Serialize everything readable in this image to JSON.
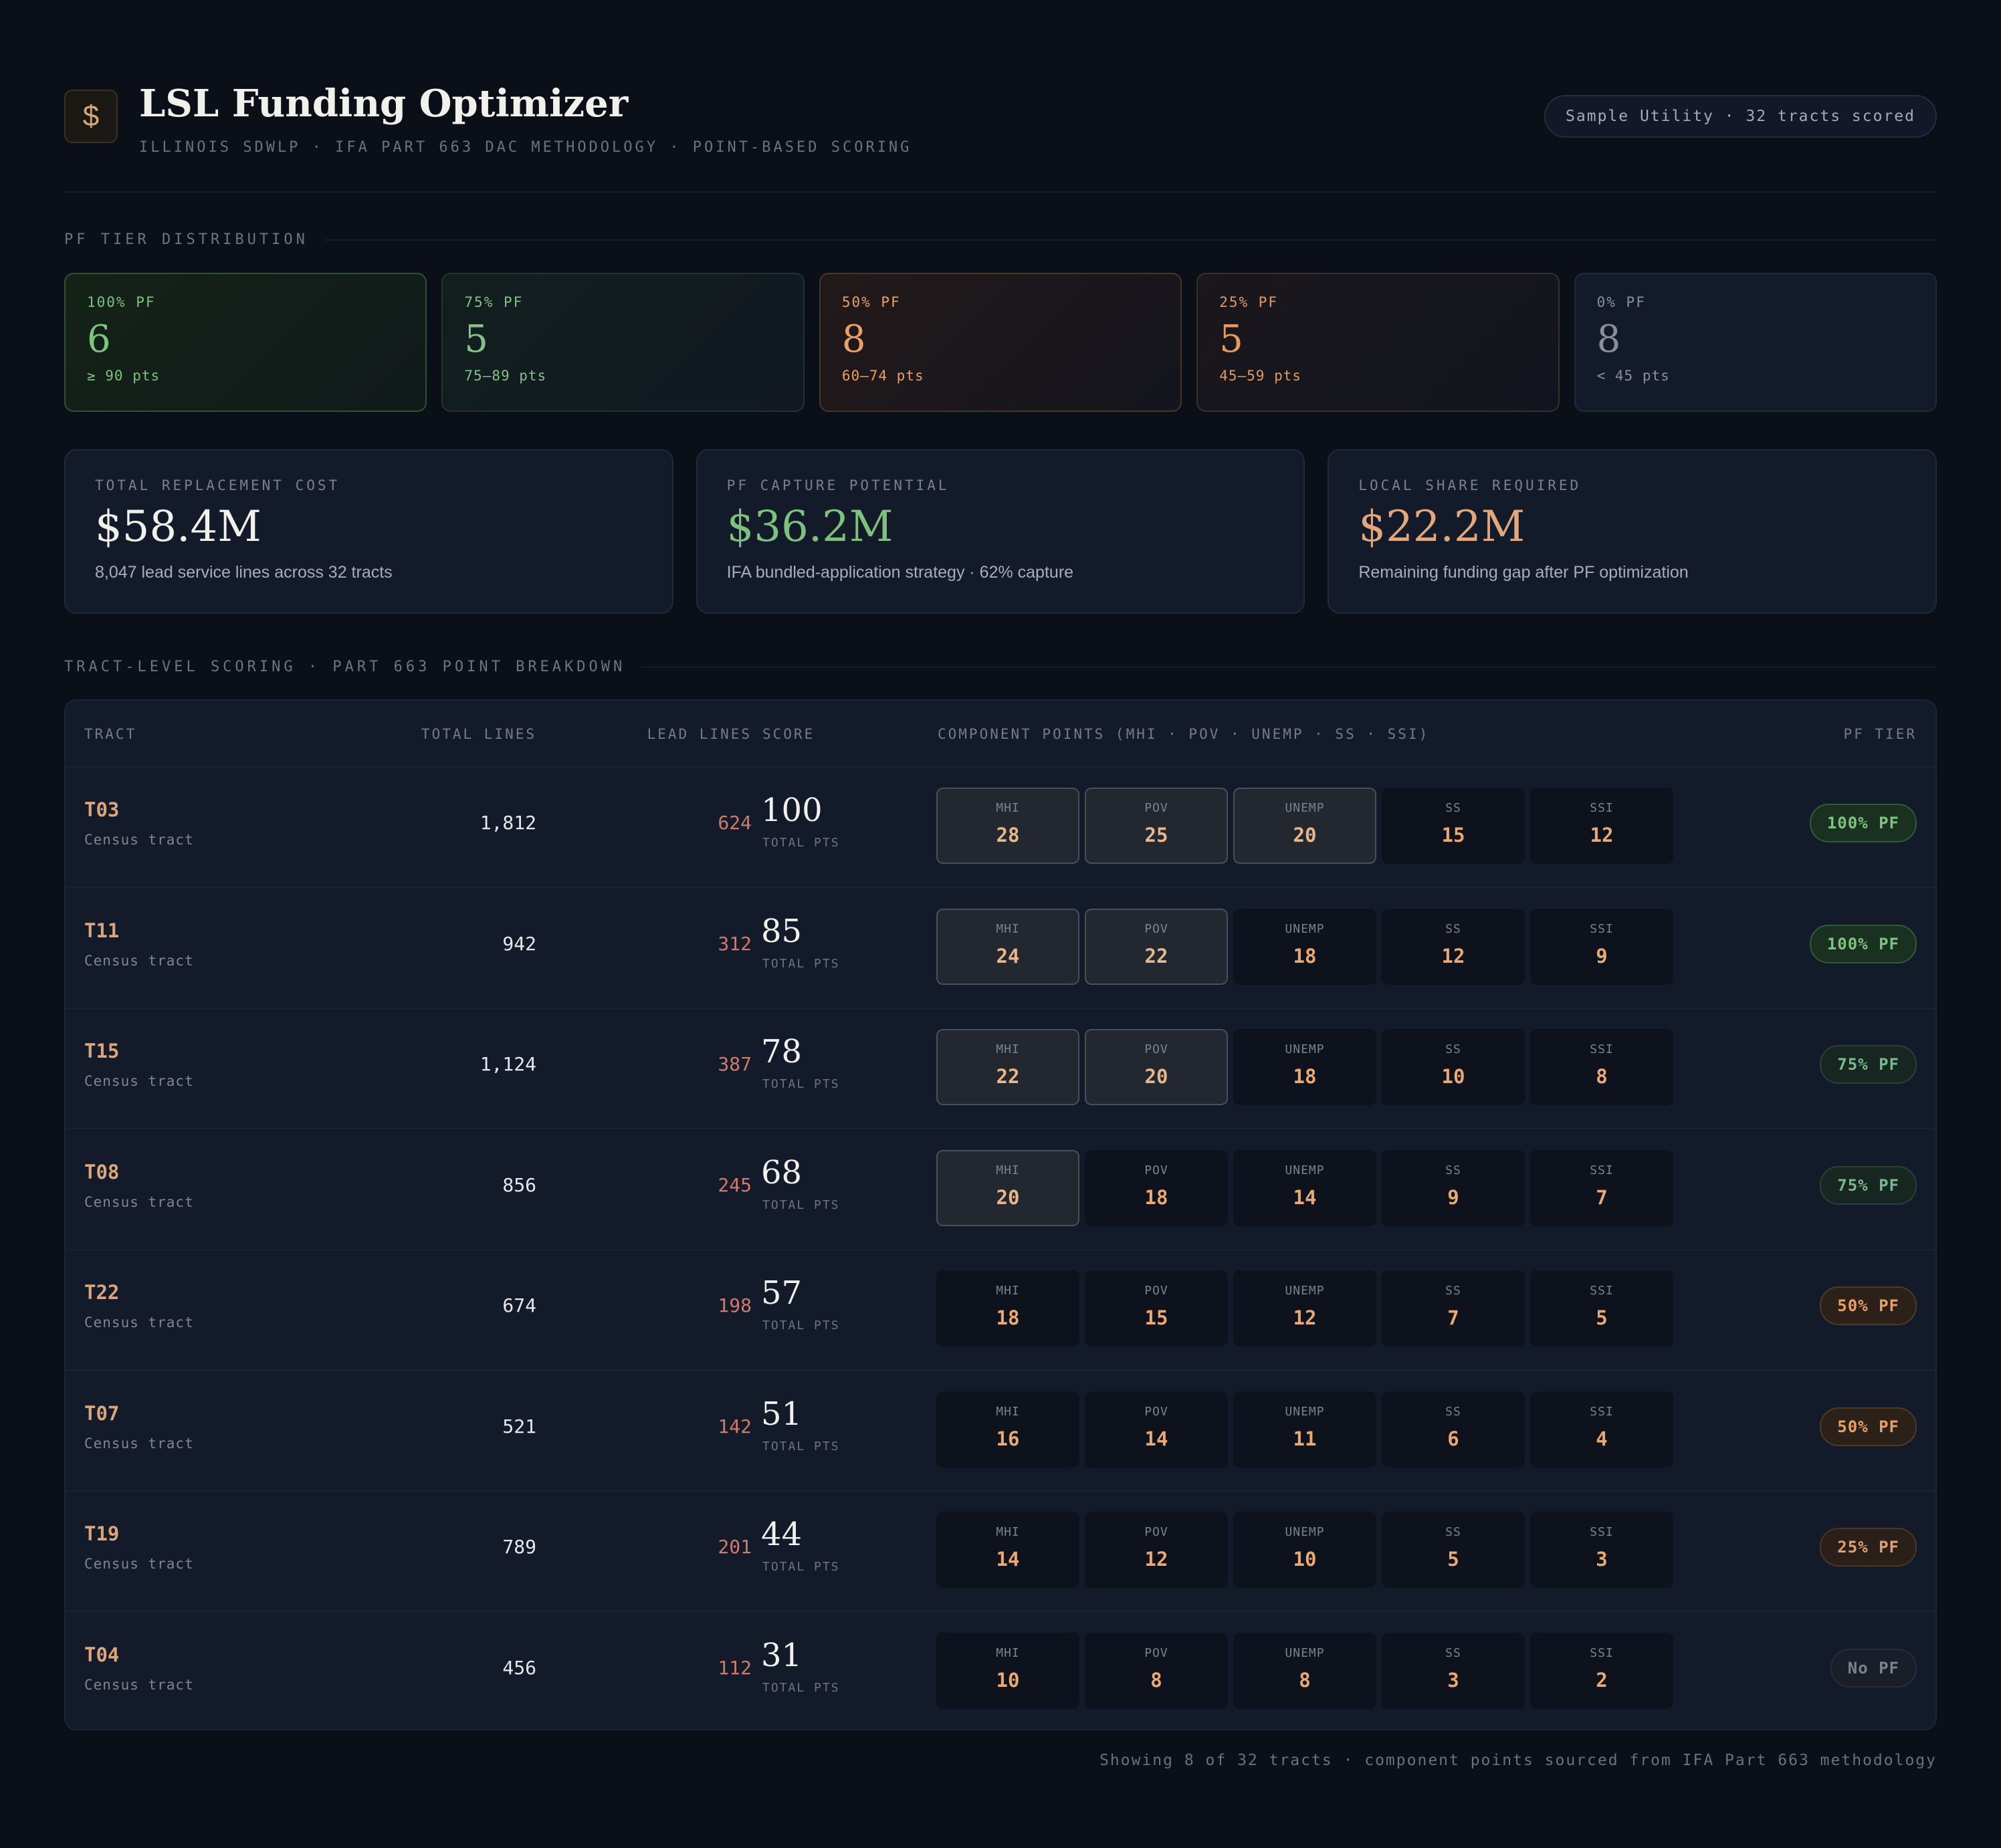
{
  "header": {
    "logo_glyph": "$",
    "title": "LSL Funding Optimizer",
    "subtitle": "ILLINOIS SDWLP · IFA PART 663 DAC METHODOLOGY · POINT-BASED SCORING",
    "pill": "Sample Utility · 32 tracts scored"
  },
  "tier_section_label": "PF TIER DISTRIBUTION",
  "tiers": [
    {
      "label": "100% PF",
      "count": "6",
      "range": "≥ 90 pts",
      "color": "#7cc47f"
    },
    {
      "label": "75% PF",
      "count": "5",
      "range": "75–89 pts",
      "color": "#86c08a"
    },
    {
      "label": "50% PF",
      "count": "8",
      "range": "60–74 pts",
      "color": "#e8a064"
    },
    {
      "label": "25% PF",
      "count": "5",
      "range": "45–59 pts",
      "color": "#e09a62"
    },
    {
      "label": "0% PF",
      "count": "8",
      "range": "< 45 pts",
      "color": "#8a8f9a"
    }
  ],
  "stats": [
    {
      "label": "TOTAL REPLACEMENT COST",
      "value": "$58.4M",
      "sub": "8,047 lead service lines across 32 tracts",
      "color": "#f2f0ea"
    },
    {
      "label": "PF CAPTURE POTENTIAL",
      "value": "$36.2M",
      "sub": "IFA bundled-application strategy · 62% capture",
      "color": "#7fc07c"
    },
    {
      "label": "LOCAL SHARE REQUIRED",
      "value": "$22.2M",
      "sub": "Remaining funding gap after PF optimization",
      "color": "#e0a87c"
    }
  ],
  "table_section_label": "TRACT-LEVEL SCORING · PART 663 POINT BREAKDOWN",
  "table": {
    "headers": {
      "tract": "TRACT",
      "total_lines": "TOTAL LINES",
      "lead_lines": "LEAD LINES",
      "score": "SCORE",
      "components": "COMPONENT POINTS (MHI · POV · UNEMP · SS · SSI)",
      "pf_tier": "PF TIER"
    },
    "component_labels": [
      "MHI",
      "POV",
      "UNEMP",
      "SS",
      "SSI"
    ],
    "tract_sub": "Census tract",
    "score_sub": "TOTAL PTS",
    "rows": [
      {
        "tract": "T03",
        "total": "1,812",
        "lead": "624",
        "score": "100",
        "comps": [
          "28",
          "25",
          "20",
          "15",
          "12"
        ],
        "highlight": [
          true,
          true,
          true,
          false,
          false
        ],
        "tier": "100% PF",
        "tier_class": "b100"
      },
      {
        "tract": "T11",
        "total": "942",
        "lead": "312",
        "score": "85",
        "comps": [
          "24",
          "22",
          "18",
          "12",
          "9"
        ],
        "highlight": [
          true,
          true,
          false,
          false,
          false
        ],
        "tier": "100% PF",
        "tier_class": "b100"
      },
      {
        "tract": "T15",
        "total": "1,124",
        "lead": "387",
        "score": "78",
        "comps": [
          "22",
          "20",
          "18",
          "10",
          "8"
        ],
        "highlight": [
          true,
          true,
          false,
          false,
          false
        ],
        "tier": "75% PF",
        "tier_class": "b75"
      },
      {
        "tract": "T08",
        "total": "856",
        "lead": "245",
        "score": "68",
        "comps": [
          "20",
          "18",
          "14",
          "9",
          "7"
        ],
        "highlight": [
          true,
          false,
          false,
          false,
          false
        ],
        "tier": "75% PF",
        "tier_class": "b75"
      },
      {
        "tract": "T22",
        "total": "674",
        "lead": "198",
        "score": "57",
        "comps": [
          "18",
          "15",
          "12",
          "7",
          "5"
        ],
        "highlight": [
          false,
          false,
          false,
          false,
          false
        ],
        "tier": "50% PF",
        "tier_class": "b50"
      },
      {
        "tract": "T07",
        "total": "521",
        "lead": "142",
        "score": "51",
        "comps": [
          "16",
          "14",
          "11",
          "6",
          "4"
        ],
        "highlight": [
          false,
          false,
          false,
          false,
          false
        ],
        "tier": "50% PF",
        "tier_class": "b50"
      },
      {
        "tract": "T19",
        "total": "789",
        "lead": "201",
        "score": "44",
        "comps": [
          "14",
          "12",
          "10",
          "5",
          "3"
        ],
        "highlight": [
          false,
          false,
          false,
          false,
          false
        ],
        "tier": "25% PF",
        "tier_class": "b25"
      },
      {
        "tract": "T04",
        "total": "456",
        "lead": "112",
        "score": "31",
        "comps": [
          "10",
          "8",
          "8",
          "3",
          "2"
        ],
        "highlight": [
          false,
          false,
          false,
          false,
          false
        ],
        "tier": "No PF",
        "tier_class": "b0"
      }
    ]
  },
  "footer": "Showing 8 of 32 tracts · component points sourced from IFA Part 663 methodology"
}
